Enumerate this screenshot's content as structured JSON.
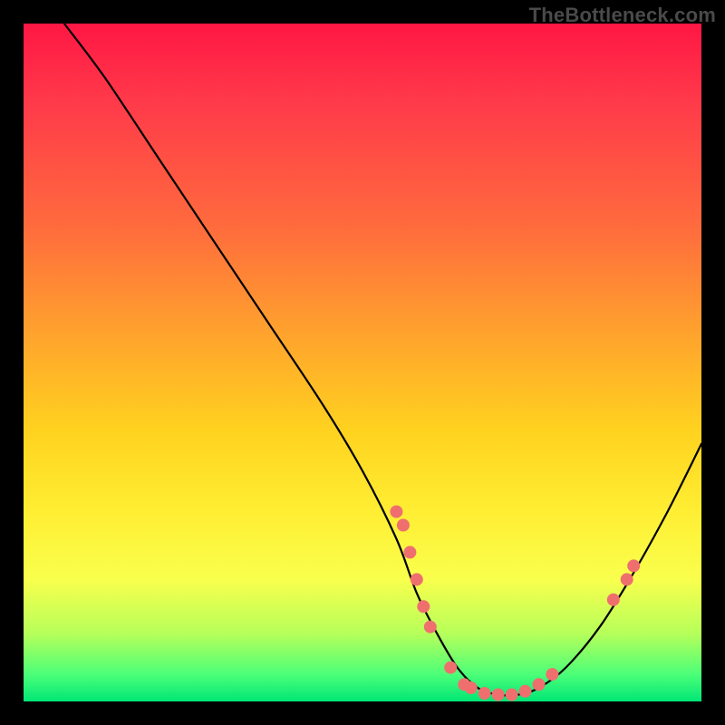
{
  "watermark": "TheBottleneck.com",
  "chart_data": {
    "type": "line",
    "title": "",
    "xlabel": "",
    "ylabel": "",
    "xlim": [
      0,
      100
    ],
    "ylim": [
      0,
      100
    ],
    "background_gradient": {
      "stops": [
        {
          "pos": 0,
          "color": "#ff1744"
        },
        {
          "pos": 12,
          "color": "#ff3b4a"
        },
        {
          "pos": 30,
          "color": "#ff6b3d"
        },
        {
          "pos": 45,
          "color": "#ffa02e"
        },
        {
          "pos": 60,
          "color": "#ffd21f"
        },
        {
          "pos": 72,
          "color": "#ffee33"
        },
        {
          "pos": 82,
          "color": "#f9ff4d"
        },
        {
          "pos": 90,
          "color": "#b6ff5a"
        },
        {
          "pos": 96,
          "color": "#4cff78"
        },
        {
          "pos": 100,
          "color": "#00e676"
        }
      ]
    },
    "series": [
      {
        "name": "bottleneck-curve",
        "color": "#000000",
        "x": [
          6,
          12,
          20,
          28,
          36,
          44,
          50,
          55,
          58,
          61,
          64,
          67,
          70,
          73,
          76,
          80,
          85,
          90,
          95,
          100
        ],
        "y": [
          100,
          92,
          80,
          68,
          56,
          44,
          34,
          24,
          16,
          10,
          5,
          2,
          1,
          1,
          2,
          5,
          11,
          19,
          28,
          38
        ]
      }
    ],
    "markers": {
      "name": "highlight-points",
      "color": "#ef6f6f",
      "radius": 7,
      "points": [
        {
          "x": 55,
          "y": 28
        },
        {
          "x": 56,
          "y": 26
        },
        {
          "x": 57,
          "y": 22
        },
        {
          "x": 58,
          "y": 18
        },
        {
          "x": 59,
          "y": 14
        },
        {
          "x": 60,
          "y": 11
        },
        {
          "x": 63,
          "y": 5
        },
        {
          "x": 65,
          "y": 2.5
        },
        {
          "x": 66,
          "y": 2
        },
        {
          "x": 68,
          "y": 1.2
        },
        {
          "x": 70,
          "y": 1
        },
        {
          "x": 72,
          "y": 1
        },
        {
          "x": 74,
          "y": 1.5
        },
        {
          "x": 76,
          "y": 2.5
        },
        {
          "x": 78,
          "y": 4
        },
        {
          "x": 87,
          "y": 15
        },
        {
          "x": 89,
          "y": 18
        },
        {
          "x": 90,
          "y": 20
        }
      ]
    }
  }
}
